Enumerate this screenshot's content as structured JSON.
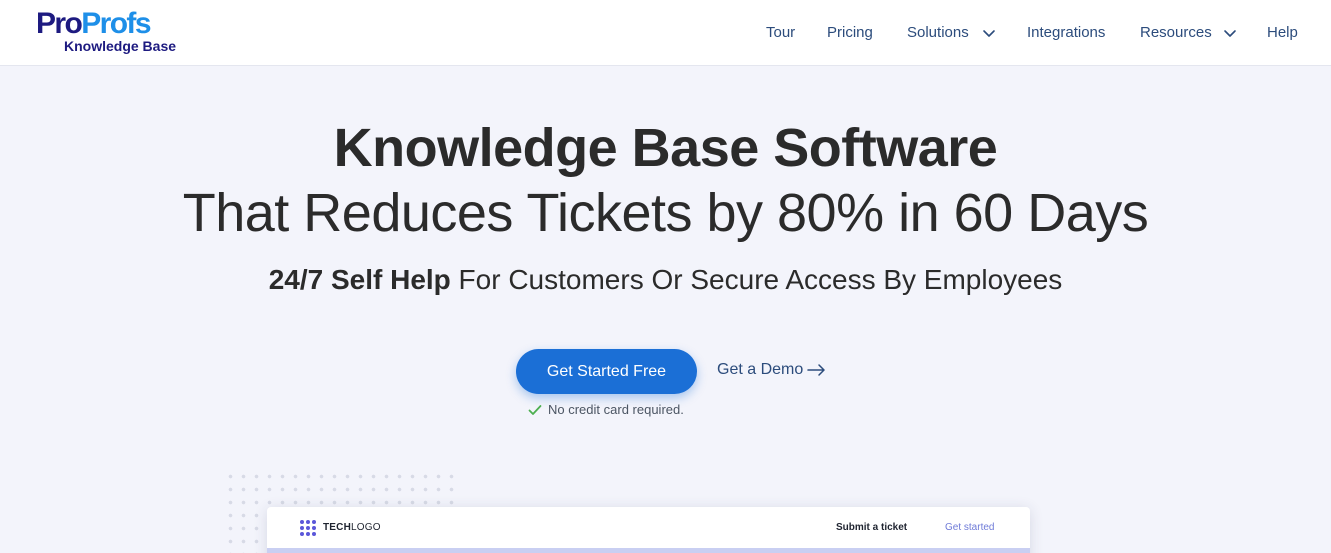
{
  "header": {
    "logo": {
      "brand_pro": "Pro",
      "brand_profs": "Profs",
      "product": "Knowledge Base"
    },
    "nav": [
      {
        "label": "Tour"
      },
      {
        "label": "Pricing"
      },
      {
        "label": "Solutions",
        "icon": "chevron-down-icon"
      },
      {
        "label": "Integrations"
      },
      {
        "label": "Resources",
        "icon": "chevron-down-icon"
      },
      {
        "label": "Help"
      }
    ]
  },
  "hero": {
    "title_line1": "Knowledge Base Software",
    "title_line2": "That Reduces Tickets by 80% in 60 Days",
    "subtitle_strong": "24/7 Self Help",
    "subtitle_rest": " For Customers Or Secure Access By Employees",
    "cta_primary": "Get Started Free",
    "cta_secondary": "Get a Demo",
    "note": "No credit card required."
  },
  "preview": {
    "logo_bold": "TECH",
    "logo_light": "LOGO",
    "link_ticket": "Submit a ticket",
    "link_started": "Get started"
  },
  "colors": {
    "brand_dark": "#1d1a80",
    "brand_light": "#1e8fe8",
    "primary_button": "#1b6fd6",
    "nav_text": "#2c4c7c",
    "check_green": "#4caf50",
    "preview_accent": "#6f7bd8"
  }
}
